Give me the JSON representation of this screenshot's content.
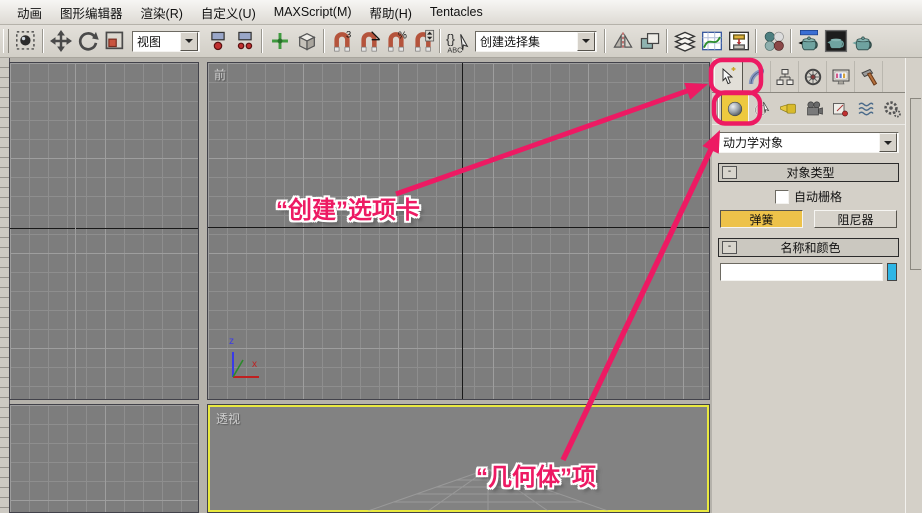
{
  "menu": {
    "items": [
      "动画",
      "图形编辑器",
      "渲染(R)",
      "自定义(U)",
      "MAXScript(M)",
      "帮助(H)",
      "Tentacles"
    ]
  },
  "toolbar": {
    "view_dropdown_value": "视图",
    "selection_set_value": "创建选择集",
    "snap_badges": {
      "snap3d": "3",
      "angle": "∠",
      "percent": "%"
    },
    "icons": [
      "select-object",
      "select-and-move",
      "select-and-rotate",
      "select-and-scale",
      "reference-coordinate",
      "use-pivot-point-center",
      "select-and-manipulate",
      "keyboard-shortcut-override",
      "snap-toggle-3d",
      "angle-snap",
      "percent-snap",
      "spinner-snap",
      "edit-named-selection-sets",
      "mirror",
      "align",
      "layer-manager",
      "curve-editor",
      "schematic-view",
      "material-editor",
      "render-setup",
      "rendered-frame-window",
      "quick-render"
    ]
  },
  "viewports": {
    "front": {
      "label": "前"
    },
    "perspective": {
      "label": "透视"
    },
    "axis_gizmo": {
      "x_label": "x",
      "z_label": "z"
    },
    "active_viewport_border_color": "#e9e93f"
  },
  "command_panel": {
    "tabs": [
      "create",
      "modify",
      "hierarchy",
      "motion",
      "display",
      "utilities"
    ],
    "active_tab": "create",
    "categories": [
      "geometry",
      "shapes",
      "lights",
      "cameras",
      "helpers",
      "space-warps",
      "systems"
    ],
    "active_category": "geometry",
    "subcategory_dropdown_value": "动力学对象",
    "object_type_rollout": {
      "collapse_glyph": "-",
      "title": "对象类型",
      "autogrid_label": "自动栅格",
      "autogrid_checked": false,
      "spring_button": "弹簧",
      "spring_button_active": true,
      "spring_button_color": "#edc24a",
      "damper_button": "阻尼器"
    },
    "name_color_rollout": {
      "collapse_glyph": "-",
      "title": "名称和颜色",
      "name_value": "",
      "swatch_color": "#2eb6e6"
    }
  },
  "annotations": {
    "accent_color": "#ed1a63",
    "create_tab_label": "“创建”选项卡",
    "geometry_item_label": "“几何体”项"
  }
}
